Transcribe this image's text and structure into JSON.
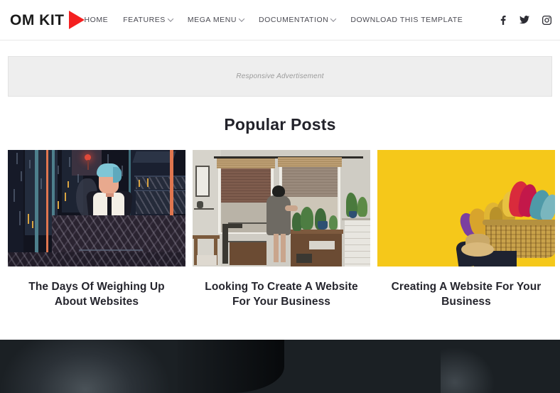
{
  "site": {
    "logo_text": "OM KIT",
    "logo_icon": "play-triangle-icon",
    "accent_color": "#f42020"
  },
  "nav": {
    "items": [
      {
        "label": "HOME",
        "has_dropdown": false
      },
      {
        "label": "FEATURES",
        "has_dropdown": true
      },
      {
        "label": "MEGA MENU",
        "has_dropdown": true
      },
      {
        "label": "DOCUMENTATION",
        "has_dropdown": true
      },
      {
        "label": "DOWNLOAD THIS TEMPLATE",
        "has_dropdown": false
      }
    ],
    "social": [
      {
        "name": "facebook-icon"
      },
      {
        "name": "twitter-icon"
      },
      {
        "name": "instagram-icon"
      },
      {
        "name": "pinterest-icon"
      }
    ]
  },
  "advertisement": {
    "label": "Responsive Advertisement"
  },
  "popular_posts": {
    "heading": "Popular Posts",
    "items": [
      {
        "title": "The Days Of Weighing Up About Websites",
        "thumb_alt": "dark-noir-illustration-person-at-desk"
      },
      {
        "title": "Looking To Create A Website For Your Business",
        "thumb_alt": "interior-room-person-by-window-with-plants"
      },
      {
        "title": "Creating A Website For Your Business",
        "thumb_alt": "yellow-wall-person-carrying-basket-of-feather-dusters"
      }
    ]
  },
  "hero": {
    "alt": "dark-banner-image"
  }
}
